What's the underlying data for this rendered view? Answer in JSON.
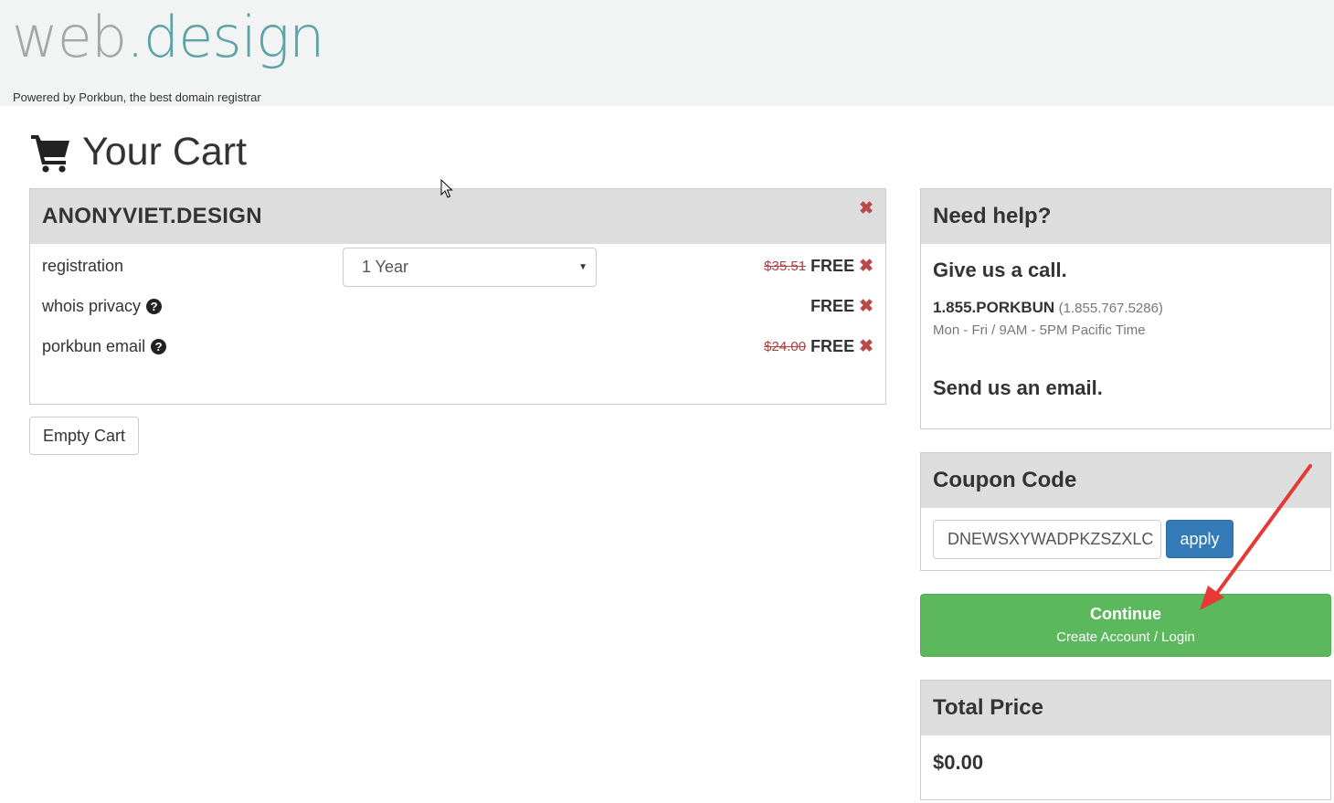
{
  "header": {
    "logo_left": "web",
    "logo_right": ".design",
    "tagline": "Powered by Porkbun, the best domain registrar"
  },
  "page": {
    "title": "Your Cart"
  },
  "cart": {
    "domain": "ANONYVIET.DESIGN",
    "items": [
      {
        "label": "registration",
        "old_price": "$35.51",
        "price": "FREE",
        "term": "1 Year"
      },
      {
        "label": "whois privacy",
        "old_price": "",
        "price": "FREE"
      },
      {
        "label": "porkbun email",
        "old_price": "$24.00",
        "price": "FREE"
      }
    ],
    "empty_label": "Empty Cart"
  },
  "help": {
    "title": "Need help?",
    "call": "Give us a call.",
    "phone": "1.855.PORKBUN",
    "phone_alt": "(1.855.767.5286)",
    "hours": "Mon - Fri / 9AM - 5PM Pacific Time",
    "email": "Send us an email."
  },
  "coupon": {
    "title": "Coupon Code",
    "value": "DNEWSXYWADPKZSZXLC",
    "apply_label": "apply"
  },
  "continue": {
    "label": "Continue",
    "sub": "Create Account / Login"
  },
  "total": {
    "title": "Total Price",
    "amount": "$0.00"
  },
  "colors": {
    "header_bg": "#f2f3f3",
    "logo_gray": "#a6a6a6",
    "logo_teal": "#5ba3aa",
    "panel_head": "#dddddd",
    "remove_red": "#b94a48",
    "apply_blue": "#337ab7",
    "continue_green": "#5cb85c",
    "annotation_arrow": "#e53935"
  }
}
